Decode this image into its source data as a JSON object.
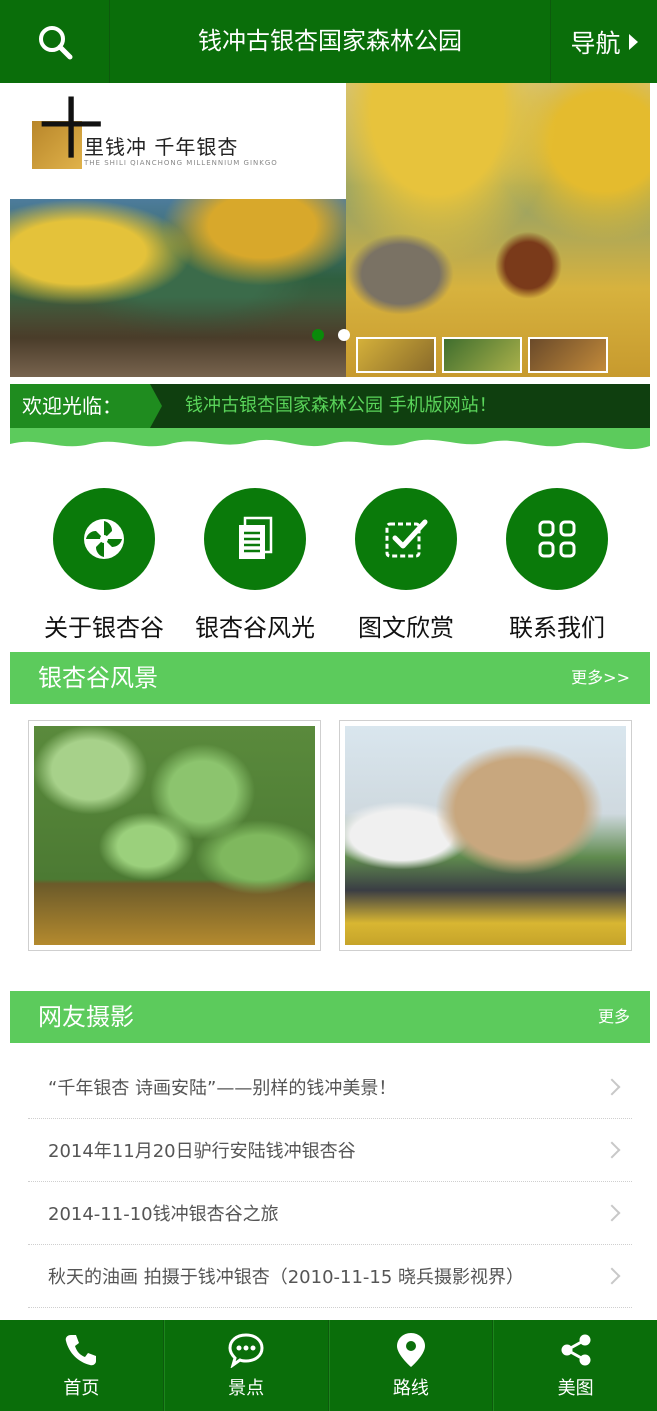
{
  "header": {
    "title": "钱冲古银杏国家森林公园",
    "nav_label": "导航"
  },
  "banner": {
    "logo_text": "里钱冲  千年银杏",
    "logo_char": "十",
    "logo_subtext": "THE SHILI QIANCHONG MILLENNIUM GINKGO"
  },
  "welcome": {
    "tag": "欢迎光临：",
    "message": "钱冲古银杏国家森林公园 手机版网站！"
  },
  "menu": [
    {
      "label": "关于银杏谷",
      "icon": "pinwheel-icon"
    },
    {
      "label": "银杏谷风光",
      "icon": "document-icon"
    },
    {
      "label": "图文欣赏",
      "icon": "checkbox-icon"
    },
    {
      "label": "联系我们",
      "icon": "grid-icon"
    }
  ],
  "scenery": {
    "title": "银杏谷风景",
    "more": "更多>>"
  },
  "photos": {
    "title": "网友摄影",
    "more": "更多",
    "items": [
      "“千年银杏 诗画安陆”——别样的钱冲美景！",
      "2014年11月20日驴行安陆钱冲银杏谷",
      "2014-11-10钱冲银杏谷之旅",
      "秋天的油画 拍摄于钱冲银杏（2010-11-15 晓兵摄影视界）"
    ]
  },
  "bottom_nav": [
    {
      "label": "首页",
      "icon": "phone-icon"
    },
    {
      "label": "景点",
      "icon": "chat-icon"
    },
    {
      "label": "路线",
      "icon": "location-pin-icon"
    },
    {
      "label": "美图",
      "icon": "share-icon"
    }
  ],
  "colors": {
    "primary": "#0a6e0a",
    "section": "#5ccb5c",
    "welcome_text": "#5ad45a"
  }
}
